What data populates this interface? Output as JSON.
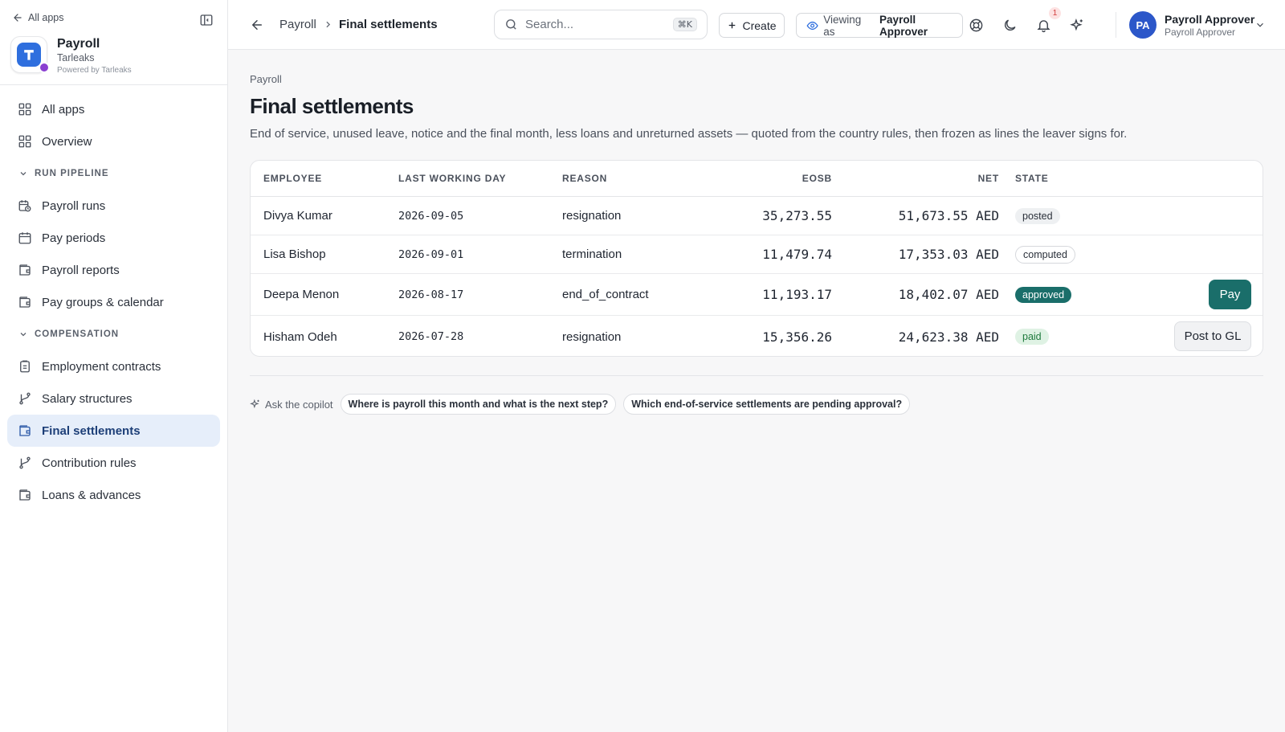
{
  "sidebar": {
    "back_link": "All apps",
    "app_name": "Payroll",
    "app_org": "Tarleaks",
    "powered_by": "Powered by Tarleaks",
    "items_top": [
      {
        "label": "All apps",
        "icon": "grid-icon"
      },
      {
        "label": "Overview",
        "icon": "grid-icon"
      }
    ],
    "sections": [
      {
        "title": "RUN PIPELINE",
        "items": [
          {
            "label": "Payroll runs",
            "icon": "calendar-clock-icon"
          },
          {
            "label": "Pay periods",
            "icon": "calendar-icon"
          },
          {
            "label": "Payroll reports",
            "icon": "wallet-icon"
          },
          {
            "label": "Pay groups & calendar",
            "icon": "wallet-icon"
          }
        ]
      },
      {
        "title": "COMPENSATION",
        "items": [
          {
            "label": "Employment contracts",
            "icon": "clipboard-icon"
          },
          {
            "label": "Salary structures",
            "icon": "branch-icon"
          },
          {
            "label": "Final settlements",
            "icon": "wallet-icon",
            "active": true
          },
          {
            "label": "Contribution rules",
            "icon": "branch-icon"
          },
          {
            "label": "Loans & advances",
            "icon": "wallet-icon"
          }
        ]
      }
    ]
  },
  "topbar": {
    "breadcrumb_parent": "Payroll",
    "breadcrumb_current": "Final settlements",
    "search_placeholder": "Search...",
    "search_shortcut": "⌘K",
    "create_label": "Create",
    "viewing_prefix": "Viewing as",
    "viewing_role": "Payroll Approver",
    "notification_count": "1",
    "avatar_initials": "PA",
    "user_name": "Payroll Approver",
    "user_role": "Payroll Approver"
  },
  "page": {
    "crumb": "Payroll",
    "title": "Final settlements",
    "description": "End of service, unused leave, notice and the final month, less loans and unreturned assets — quoted from the country rules, then frozen as lines the leaver signs for."
  },
  "table": {
    "columns": [
      "EMPLOYEE",
      "LAST WORKING DAY",
      "REASON",
      "EOSB",
      "NET",
      "STATE"
    ],
    "rows": [
      {
        "employee": "Divya Kumar",
        "last_day": "2026-09-05",
        "reason": "resignation",
        "eosb": "35,273.55",
        "net": "51,673.55 AED",
        "state": "posted",
        "action": ""
      },
      {
        "employee": "Lisa Bishop",
        "last_day": "2026-09-01",
        "reason": "termination",
        "eosb": "11,479.74",
        "net": "17,353.03 AED",
        "state": "computed",
        "action": ""
      },
      {
        "employee": "Deepa Menon",
        "last_day": "2026-08-17",
        "reason": "end_of_contract",
        "eosb": "11,193.17",
        "net": "18,402.07 AED",
        "state": "approved",
        "action": "Pay"
      },
      {
        "employee": "Hisham Odeh",
        "last_day": "2026-07-28",
        "reason": "resignation",
        "eosb": "15,356.26",
        "net": "24,623.38 AED",
        "state": "paid",
        "action": "Post to GL"
      }
    ]
  },
  "copilot": {
    "label": "Ask the copilot",
    "suggestions": [
      "Where is payroll this month and what is the next step?",
      "Which end-of-service settlements are pending approval?"
    ]
  },
  "colors": {
    "accent": "#2f6fde",
    "active_nav_bg": "#e6eefa",
    "approved": "#1a6e6a",
    "paid_bg": "#dff2e4",
    "avatar": "#2c57c9"
  }
}
